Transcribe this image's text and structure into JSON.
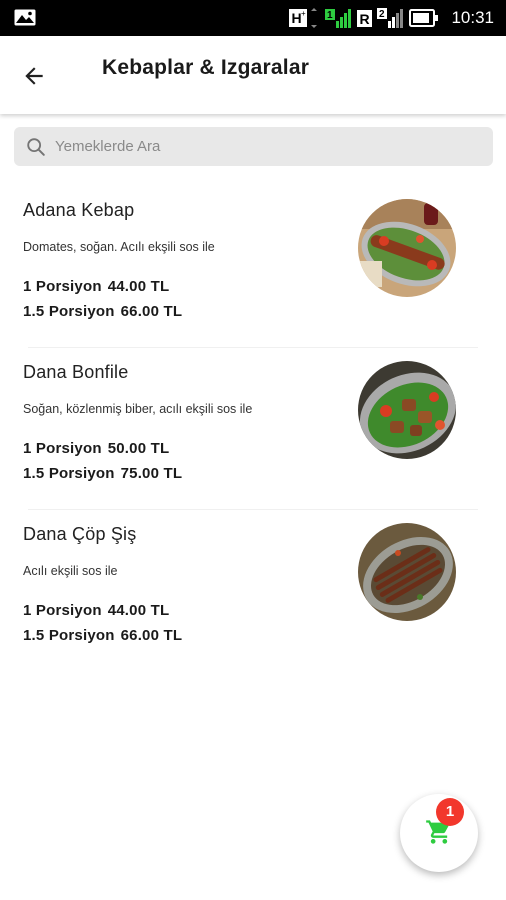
{
  "status_bar": {
    "time": "10:31",
    "network_label": "H",
    "sim1_label": "1",
    "sim2_label": "R",
    "sim3_label": "2"
  },
  "toolbar": {
    "title": "Kebaplar & Izgaralar"
  },
  "search": {
    "placeholder": "Yemeklerde Ara"
  },
  "items": [
    {
      "name": "Adana Kebap",
      "description": "Domates, soğan. Acılı ekşili sos ile",
      "prices": [
        {
          "portion": "1 Porsiyon",
          "price": "44.00 TL"
        },
        {
          "portion": "1.5 Porsiyon",
          "price": "66.00 TL"
        }
      ]
    },
    {
      "name": "Dana Bonfile",
      "description": "Soğan, közlenmiş biber, acılı ekşili sos ile",
      "prices": [
        {
          "portion": "1 Porsiyon",
          "price": "50.00 TL"
        },
        {
          "portion": "1.5 Porsiyon",
          "price": "75.00 TL"
        }
      ]
    },
    {
      "name": "Dana Çöp Şiş",
      "description": "Acılı ekşili sos ile",
      "prices": [
        {
          "portion": "1 Porsiyon",
          "price": "44.00 TL"
        },
        {
          "portion": "1.5 Porsiyon",
          "price": "66.00 TL"
        }
      ]
    }
  ],
  "cart": {
    "badge_count": "1",
    "icon": "shopping-cart-icon",
    "icon_color": "#2ecc40",
    "badge_color": "#f2372c"
  }
}
